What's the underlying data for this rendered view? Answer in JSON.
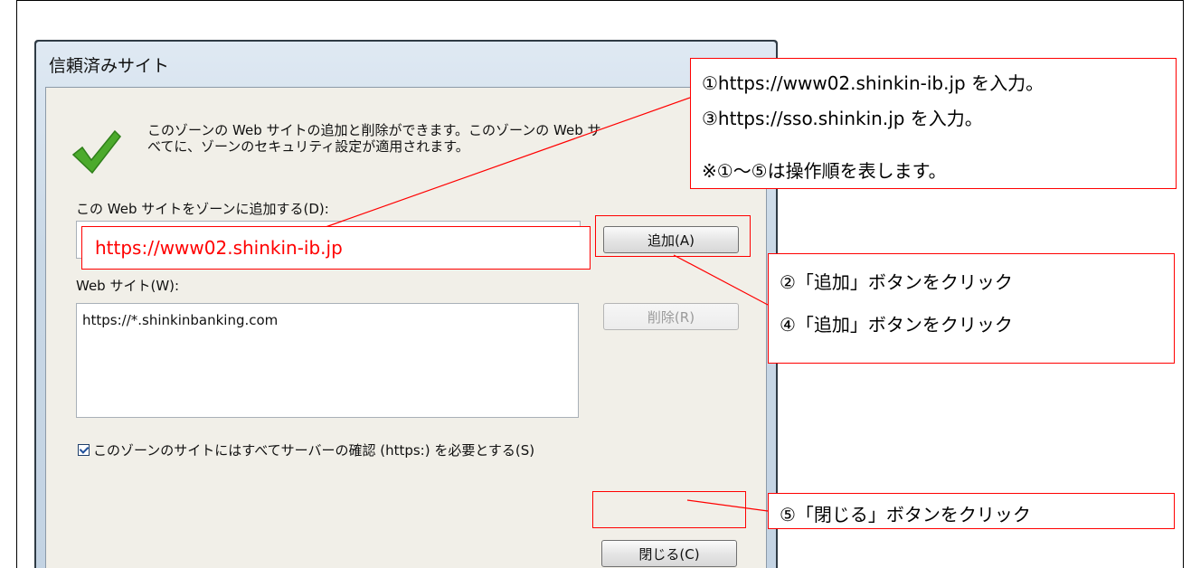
{
  "dialog": {
    "title": "信頼済みサイト",
    "description": "このゾーンの Web サイトの追加と削除ができます。このゾーンの Web サ\nべてに、ゾーンのセキュリティ設定が適用されます。",
    "add_site_label": "この Web サイトをゾーンに追加する(D):",
    "add_site_input_value": "https://www02.shinkin-ib.jp",
    "add_button_label": "追加(A)",
    "websites_label": "Web サイト(W):",
    "websites": [
      "https://*.shinkinbanking.com"
    ],
    "remove_button_label": "削除(R)",
    "require_https_label": "このゾーンのサイトにはすべてサーバーの確認 (https:) を必要とする(S)",
    "require_https_checked": true,
    "close_button_label": "閉じる(C)"
  },
  "annotations": {
    "input_callout": [
      "①https://www02.shinkin-ib.jp を入力。",
      "③https://sso.shinkin.jp を入力。",
      "※①～⑤は操作順を表します。"
    ],
    "add_callout": [
      "②「追加」ボタンをクリック",
      "④「追加」ボタンをクリック"
    ],
    "close_callout": "⑤「閉じる」ボタンをクリック",
    "highlight_color": "#ff0000"
  }
}
